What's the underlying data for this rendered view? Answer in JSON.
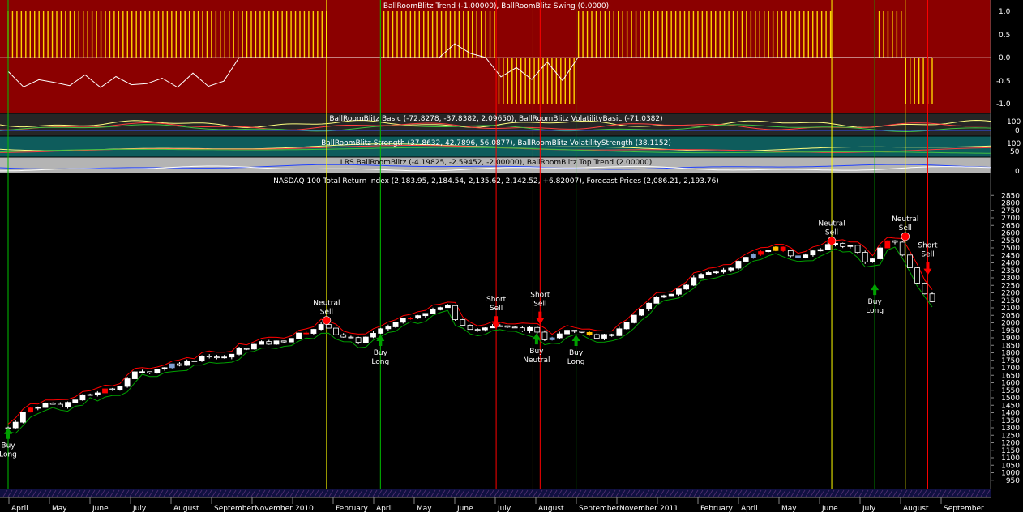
{
  "panels": {
    "trend_title": "BallRoomBlitz Trend (-1.00000), BallRoomBlitz Swing (0.0000)",
    "basic_title": "BallRoomBlitz Basic (-72.8278, -37.8382, 2.09650), BallRoomBlitz VolatilityBasic (-71.0382)",
    "strength_title": "BallRoomBlitz Strength (37.8632, 42.7896, 56.0877), BallRoomBlitz VolatilityStrength (38.1152)",
    "lrs_title": "LRS BallRoomBlitz (-4.19825, -2.59452, -2.00000), BallRoomBlitz Top Trend (2.00000)",
    "price_title": "NASDAQ 100 Total Return Index (2,183.95, 2,184.54, 2,135.62, 2,142.52, +6.82007), Forecast Prices (2,086.21, 2,193.76)",
    "trend_ticks": [
      "1.0",
      "0.5",
      "0.0",
      "-0.5",
      "-1.0"
    ],
    "basic_ticks": [
      "100",
      "0"
    ],
    "strength_ticks": [
      "100",
      "50"
    ],
    "lrs_ticks": [
      "0"
    ]
  },
  "colors": {
    "trend_bg": "#8b0000",
    "basic_bg": "#262626",
    "strength_bg": "#0e5c5c",
    "lrs_bg": "#b4b4b4",
    "candle_up": "#ffffff",
    "candle_down_bear": "#7f9fd0",
    "candle_red": "#ff0000",
    "candle_yellow": "#ffc000",
    "upper_band": "#ff0000",
    "lower_band": "#00a000",
    "vline_yellow": "#ffff00",
    "vline_green": "#00c000",
    "vline_red": "#ff0000"
  },
  "x_axis": {
    "labels": [
      "April",
      "May",
      "June",
      "July",
      "August",
      "September",
      "November",
      "2010",
      "February",
      "April",
      "May",
      "June",
      "July",
      "August",
      "September",
      "November",
      "2011",
      "February",
      "April",
      "May",
      "June",
      "July",
      "August",
      "September"
    ]
  },
  "chart_data": {
    "type": "candlestick",
    "title": "NASDAQ 100 Total Return Index (2,183.95, 2,184.54, 2,135.62, 2,142.52, +6.82007), Forecast Prices (2,086.21, 2,193.76)",
    "ylim": [
      900,
      2900
    ],
    "y_ticks": [
      950,
      1000,
      1050,
      1100,
      1150,
      1200,
      1250,
      1300,
      1350,
      1400,
      1450,
      1500,
      1550,
      1600,
      1650,
      1700,
      1750,
      1800,
      1850,
      1900,
      1950,
      2000,
      2050,
      2100,
      2150,
      2200,
      2250,
      2300,
      2350,
      2400,
      2450,
      2500,
      2550,
      2600,
      2650,
      2700,
      2750,
      2800,
      2850
    ],
    "close_path": [
      [
        0,
        1300
      ],
      [
        0.02,
        1420
      ],
      [
        0.04,
        1460
      ],
      [
        0.06,
        1450
      ],
      [
        0.08,
        1500
      ],
      [
        0.1,
        1540
      ],
      [
        0.12,
        1570
      ],
      [
        0.14,
        1660
      ],
      [
        0.16,
        1680
      ],
      [
        0.18,
        1720
      ],
      [
        0.2,
        1740
      ],
      [
        0.22,
        1790
      ],
      [
        0.24,
        1760
      ],
      [
        0.26,
        1830
      ],
      [
        0.28,
        1860
      ],
      [
        0.3,
        1870
      ],
      [
        0.32,
        1910
      ],
      [
        0.34,
        1960
      ],
      [
        0.355,
        1990
      ],
      [
        0.37,
        1900
      ],
      [
        0.39,
        1880
      ],
      [
        0.41,
        1930
      ],
      [
        0.43,
        2000
      ],
      [
        0.45,
        2050
      ],
      [
        0.47,
        2080
      ],
      [
        0.49,
        2110
      ],
      [
        0.5,
        2020
      ],
      [
        0.52,
        1950
      ],
      [
        0.54,
        1980
      ],
      [
        0.56,
        1960
      ],
      [
        0.58,
        1960
      ],
      [
        0.6,
        1890
      ],
      [
        0.62,
        1960
      ],
      [
        0.64,
        1950
      ],
      [
        0.66,
        1900
      ],
      [
        0.68,
        1940
      ],
      [
        0.7,
        2050
      ],
      [
        0.72,
        2160
      ],
      [
        0.74,
        2200
      ],
      [
        0.76,
        2280
      ],
      [
        0.78,
        2330
      ],
      [
        0.8,
        2360
      ],
      [
        0.82,
        2420
      ],
      [
        0.84,
        2490
      ],
      [
        0.86,
        2500
      ],
      [
        0.88,
        2420
      ],
      [
        0.9,
        2490
      ],
      [
        0.92,
        2530
      ],
      [
        0.94,
        2510
      ],
      [
        0.95,
        2450
      ],
      [
        0.96,
        2390
      ],
      [
        0.975,
        2530
      ],
      [
        0.99,
        2540
      ],
      [
        1.0,
        2420
      ],
      [
        1.01,
        2300
      ],
      [
        1.03,
        2142
      ]
    ],
    "signals": [
      {
        "label": [
          "Buy",
          "Long"
        ],
        "kind": "buy",
        "at": 0.0,
        "price": 1280
      },
      {
        "label": [
          "Neutral",
          "Sell"
        ],
        "kind": "neutral",
        "at": 0.355,
        "price": 2000
      },
      {
        "label": [
          "Buy",
          "Long"
        ],
        "kind": "buy",
        "at": 0.415,
        "price": 1900
      },
      {
        "label": [
          "Short",
          "Sell"
        ],
        "kind": "short",
        "at": 0.544,
        "price": 1980
      },
      {
        "label": [
          "Short",
          "Sell"
        ],
        "kind": "short",
        "at": 0.593,
        "price": 2010
      },
      {
        "label": [
          "Buy",
          "Neutral"
        ],
        "kind": "buyneutral",
        "at": 0.589,
        "price": 1910
      },
      {
        "label": [
          "Buy",
          "Long"
        ],
        "kind": "buy",
        "at": 0.633,
        "price": 1900
      },
      {
        "label": [
          "Neutral",
          "Sell"
        ],
        "kind": "neutral",
        "at": 0.918,
        "price": 2530
      },
      {
        "label": [
          "Buy",
          "Long"
        ],
        "kind": "buy",
        "at": 0.966,
        "price": 2240
      },
      {
        "label": [
          "Neutral",
          "Sell"
        ],
        "kind": "neutral",
        "at": 1.0,
        "price": 2560
      },
      {
        "label": [
          "Short",
          "Sell"
        ],
        "kind": "short",
        "at": 1.025,
        "price": 2340
      }
    ],
    "vertical_lines": [
      {
        "at": 0.0,
        "color": "green"
      },
      {
        "at": 0.355,
        "color": "yellow"
      },
      {
        "at": 0.415,
        "color": "green"
      },
      {
        "at": 0.544,
        "color": "red"
      },
      {
        "at": 0.585,
        "color": "yellow"
      },
      {
        "at": 0.593,
        "color": "red"
      },
      {
        "at": 0.633,
        "color": "green"
      },
      {
        "at": 0.918,
        "color": "yellow"
      },
      {
        "at": 0.966,
        "color": "green"
      },
      {
        "at": 1.0,
        "color": "yellow"
      },
      {
        "at": 1.025,
        "color": "red"
      }
    ]
  }
}
